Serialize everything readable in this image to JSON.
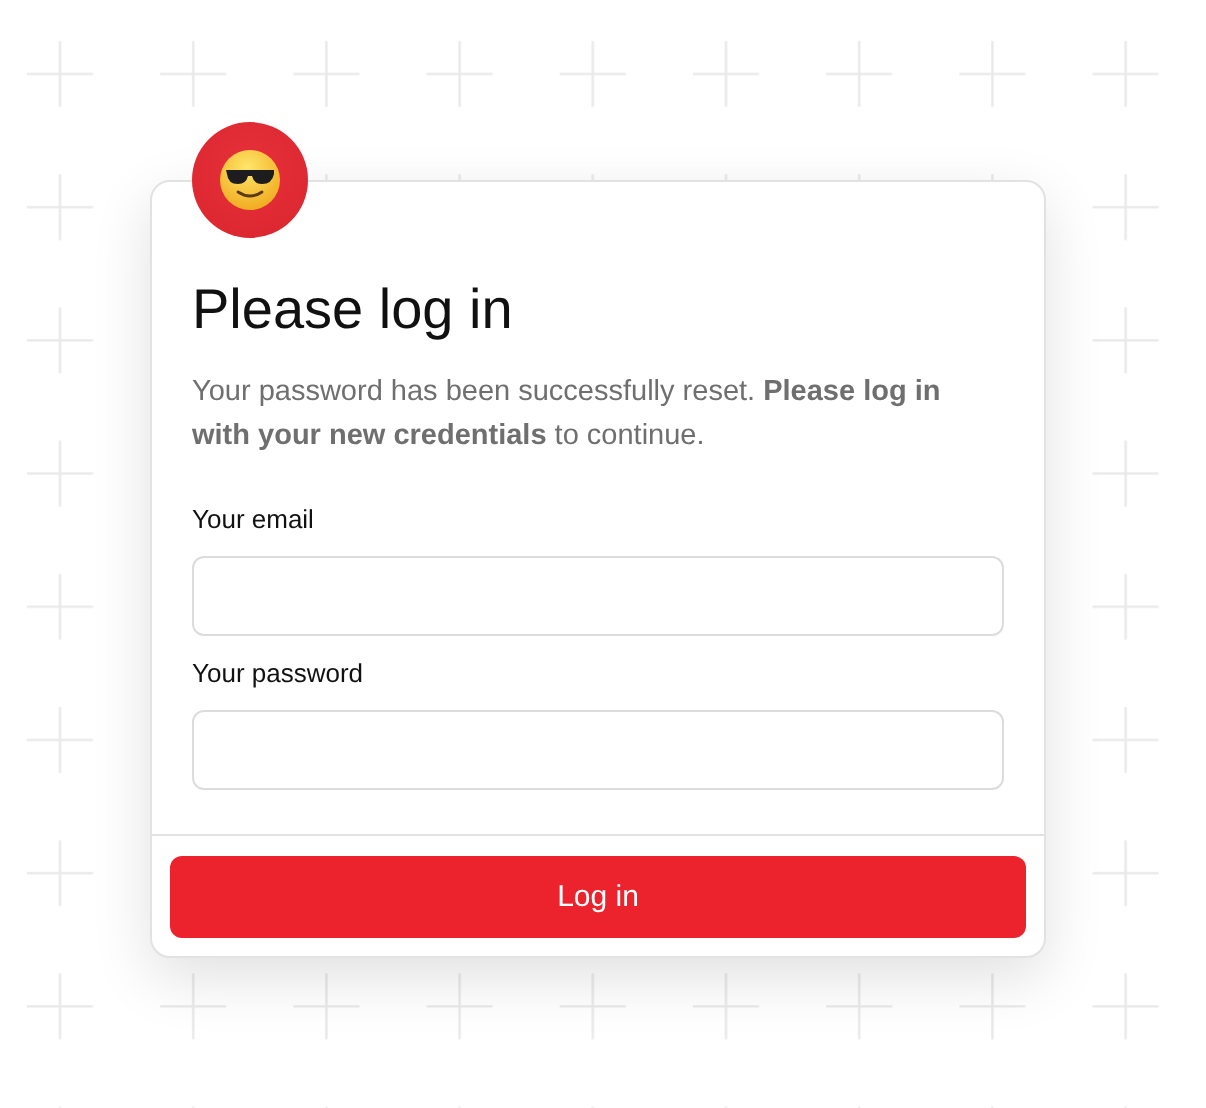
{
  "title": "Please log in",
  "message": "Your password has been successfully reset. **Please log in with your new credentials** to continue.",
  "fields": [
    {
      "label": "Your email"
    },
    {
      "label": "Your password"
    }
  ],
  "submit": "Log in"
}
